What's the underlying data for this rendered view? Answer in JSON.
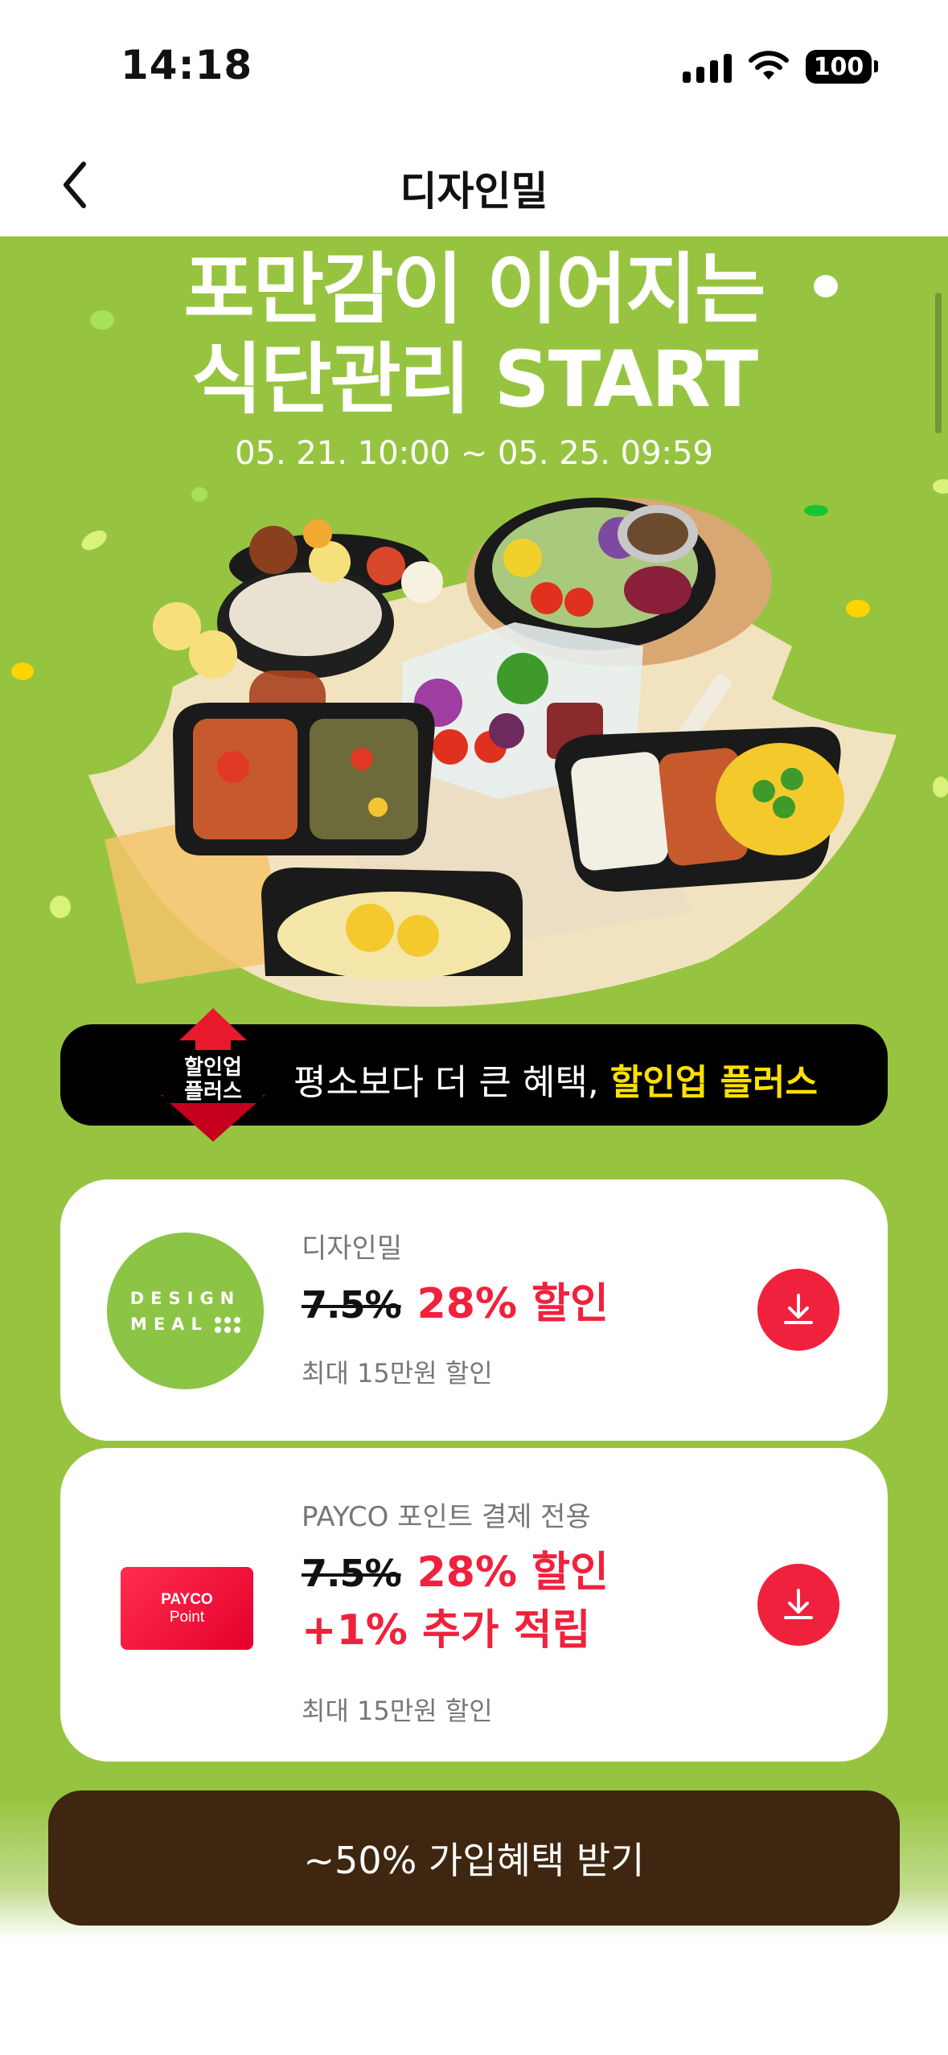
{
  "status_bar": {
    "time": "14:18",
    "battery": "100"
  },
  "nav": {
    "title": "디자인밀"
  },
  "hero": {
    "title_line1": "포만감이 이어지는",
    "title_line2": "식단관리 START",
    "period": "05. 21. 10:00 ~ 05. 25. 09:59"
  },
  "promo": {
    "badge_line1": "할인업",
    "badge_line2": "플러스",
    "text": "평소보다 더 큰 혜택, ",
    "highlight": "할인업 플러스"
  },
  "coupons": [
    {
      "logo_line1": "DESIGN",
      "logo_line2": "MEAL",
      "brand": "디자인밀",
      "old_rate": "7.5%",
      "new_rate": "28% 할인",
      "extra": "",
      "max": "최대 15만원 할인"
    },
    {
      "logo_line1": "PAYCO",
      "logo_line2": "Point",
      "brand": "PAYCO 포인트 결제 전용",
      "old_rate": "7.5%",
      "new_rate": "28% 할인",
      "extra": "+1% 추가 적립",
      "max": "최대 15만원 할인"
    }
  ],
  "cta": {
    "label": "~50% 가입혜택 받기"
  },
  "colors": {
    "background": "#97c440",
    "accent": "#f0213c",
    "cta": "#3e2610",
    "highlight": "#ffe100"
  },
  "icons": [
    "back-chevron-icon",
    "signal-icon",
    "wifi-icon",
    "battery-icon",
    "download-icon"
  ]
}
